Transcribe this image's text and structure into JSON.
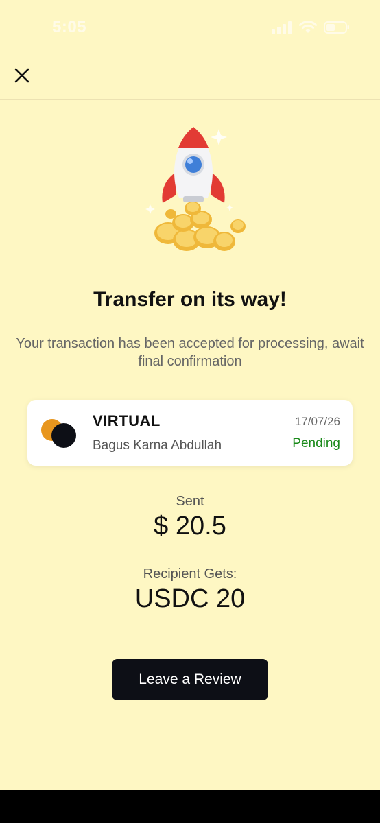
{
  "status_bar": {
    "time": "5:05"
  },
  "header": {
    "close_icon": "close-icon"
  },
  "illustration": {
    "icon": "rocket-with-coins-icon"
  },
  "main": {
    "title": "Transfer on its way!",
    "subtitle": "Your transaction has been accepted for processing, await final confirmation"
  },
  "transaction_card": {
    "name": "VIRTUAL",
    "recipient": "Bagus Karna Abdullah",
    "date": "17/07/26",
    "status": "Pending",
    "status_color": "#1a8a1a"
  },
  "amounts": {
    "sent_label": "Sent",
    "sent_value": "$ 20.5",
    "gets_label": "Recipient Gets:",
    "gets_value": "USDC 20"
  },
  "actions": {
    "review_button": "Leave a Review"
  },
  "colors": {
    "background": "#FEF7C3",
    "button": "#0d0f16",
    "logo_orange": "#E8961E",
    "logo_dark": "#0d0f16"
  }
}
